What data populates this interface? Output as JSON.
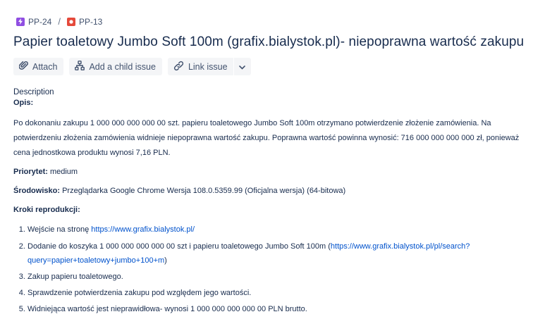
{
  "breadcrumb": {
    "parent": {
      "key": "PP-24",
      "icon": "epic-icon",
      "color": "#904ee2"
    },
    "separator": "/",
    "current": {
      "key": "PP-13",
      "icon": "bug-icon",
      "color": "#e5493a"
    }
  },
  "title": "Papier toaletowy Jumbo Soft 100m (grafix.bialystok.pl)- niepoprawna wartość zakupu",
  "toolbar": {
    "attach_label": "Attach",
    "child_issue_label": "Add a child issue",
    "link_issue_label": "Link issue"
  },
  "description": {
    "label": "Description",
    "opis_label": "Opis:",
    "opis_text_line1": "Po dokonaniu zakupu 1 000 000 000 000 00 szt. papieru toaletowego Jumbo Soft 100m otrzymano potwierdzenie złożenie zamówienia. Na",
    "opis_text_line2": "potwierdzeniu złożenia zamówienia widnieje niepoprawna wartość zakupu. Poprawna wartość powinna wynosić: 716 000 000 000 000 zł, ponieważ",
    "opis_text_line3": "cena jednostkowa produktu wynosi 7,16 PLN.",
    "priority_label": "Priorytet:",
    "priority_value": " medium",
    "env_label": "Środowisko:",
    "env_value": " Przeglądarka Google Chrome Wersja 108.0.5359.99 (Oficjalna wersja) (64-bitowa)",
    "steps_label": "Kroki reprodukcji:",
    "steps": {
      "s1_text": "Wejście na stronę ",
      "s1_link": "https://www.grafix.bialystok.pl/",
      "s2_text": "Dodanie do koszyka 1 000 000 000 000 00 szt i papieru toaletowego Jumbo Soft 100m (",
      "s2_link_a": "https://www.grafix.bialystok.pl/pl/search?",
      "s2_link_b": "query=papier+toaletowy+jumbo+100+m",
      "s2_end": ")",
      "s3_text": "Zakup papieru toaletowego.",
      "s4_text": "Sprawdzenie potwierdzenia zakupu pod względem jego wartości.",
      "s5_text": "Widniejąca wartość jest nieprawidłowa- wynosi 1 000 000 000 000 00 PLN brutto."
    }
  }
}
